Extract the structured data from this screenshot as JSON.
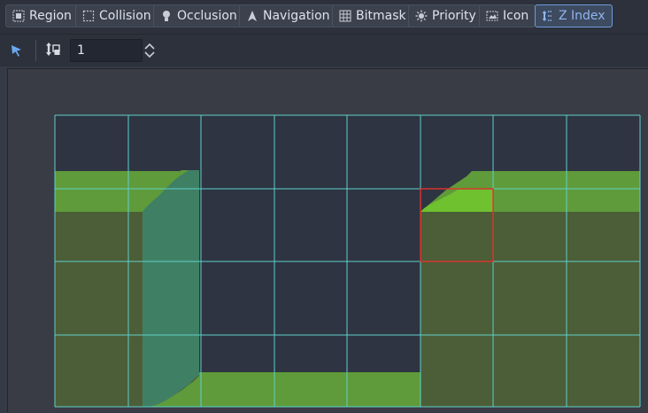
{
  "mode_bar": {
    "buttons": [
      {
        "id": "region",
        "label": "Region",
        "icon": "region-icon"
      },
      {
        "id": "collision",
        "label": "Collision",
        "icon": "collision-icon"
      },
      {
        "id": "occlusion",
        "label": "Occlusion",
        "icon": "occlusion-icon"
      },
      {
        "id": "navigation",
        "label": "Navigation",
        "icon": "navigation-icon"
      },
      {
        "id": "bitmask",
        "label": "Bitmask",
        "icon": "bitmask-icon"
      },
      {
        "id": "priority",
        "label": "Priority",
        "icon": "priority-icon"
      },
      {
        "id": "icon",
        "label": "Icon",
        "icon": "icon-mode-icon"
      },
      {
        "id": "zindex",
        "label": "Z Index",
        "icon": "z-index-icon",
        "active": true
      }
    ]
  },
  "toolbar": {
    "select_tool": "select-arrow-icon",
    "z_tool": "z-index-tool-icon",
    "z_value": "1"
  },
  "colors": {
    "grid": "#5fd0c9",
    "selected": "#e0322c",
    "grass": "#5f9b3a",
    "dirt": "#4b5e38",
    "highlight": "#6fc12f",
    "teal": "#3f8064",
    "empty": "#2e3442",
    "accent": "#8fb6ee"
  }
}
